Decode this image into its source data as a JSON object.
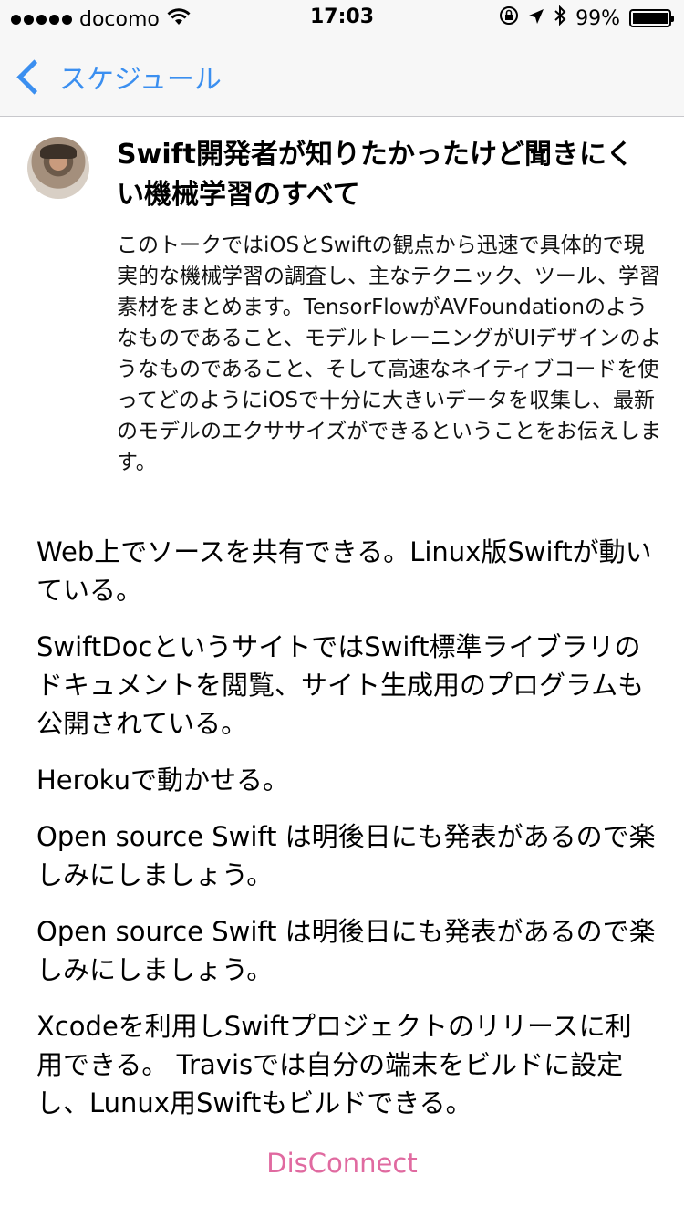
{
  "status_bar": {
    "carrier": "docomo",
    "time": "17:03",
    "battery_text": "99%",
    "battery_level": 0.99,
    "icons": [
      "wifi-icon",
      "rotation-lock-icon",
      "location-arrow-icon",
      "bluetooth-icon",
      "battery-icon"
    ]
  },
  "nav": {
    "back_label": "スケジュール"
  },
  "session": {
    "title": "Swift開発者が知りたかったけど聞きにくい機械学習のすべて",
    "description": "このトークではiOSとSwiftの観点から迅速で具体的で現実的な機械学習の調査し、主なテクニック、ツール、学習素材をまとめます。TensorFlowがAVFoundationのようなものであること、モデルトレーニングがUIデザインのようなものであること、そして高速なネイティブコードを使ってどのようにiOSで十分に大きいデータを収集し、最新のモデルのエクササイズができるということをお伝えします。"
  },
  "notes": [
    "Web上でソースを共有できる。Linux版Swiftが動いている。",
    "SwiftDocというサイトではSwift標準ライブラリのドキュメントを閲覧、サイト生成用のプログラムも公開されている。",
    "Herokuで動かせる。",
    "Open source Swift は明後日にも発表があるので楽しみにしましょう。",
    "Open source Swift は明後日にも発表があるので楽しみにしましょう。",
    "Xcodeを利用しSwiftプロジェクトのリリースに利用できる。 Travisでは自分の端末をビルドに設定し、Lunux用Swiftもビルドできる。"
  ],
  "footer": {
    "disconnect_label": "DisConnect"
  },
  "colors": {
    "accent": "#3b8ff0",
    "disconnect": "#e06aa0",
    "bar_background": "#f7f7f7"
  }
}
